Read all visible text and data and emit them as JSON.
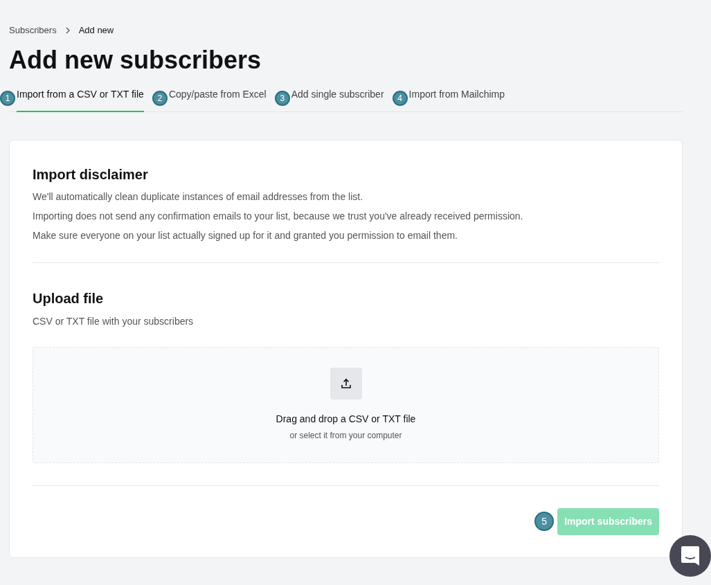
{
  "breadcrumb": [
    "Subscribers",
    "Add new"
  ],
  "title": "Add new subscribers",
  "tabs": [
    {
      "marker": "1",
      "label": "Import from a CSV or TXT file",
      "selected": true
    },
    {
      "marker": "2",
      "label": "Copy/paste from Excel",
      "selected": false
    },
    {
      "marker": "3",
      "label": "Add single subscriber",
      "selected": false
    },
    {
      "marker": "4",
      "label": "Import from Mailchimp",
      "selected": false
    }
  ],
  "disclaimer": {
    "title": "Import disclaimer",
    "lines": [
      "We'll automatically clean duplicate instances of email addresses from the list.",
      "Importing does not send any confirmation emails to your list, because we trust you've already received permission.",
      "Make sure everyone on your list actually signed up for it and granted you permission to email them."
    ]
  },
  "upload": {
    "title": "Upload file",
    "subtitle": "CSV or TXT file with your subscribers",
    "drop_text": "Drag and drop a CSV or TXT file",
    "drop_hint": "or select it from your computer"
  },
  "import_button": {
    "marker": "5",
    "label": "Import subscribers",
    "disabled": true
  }
}
